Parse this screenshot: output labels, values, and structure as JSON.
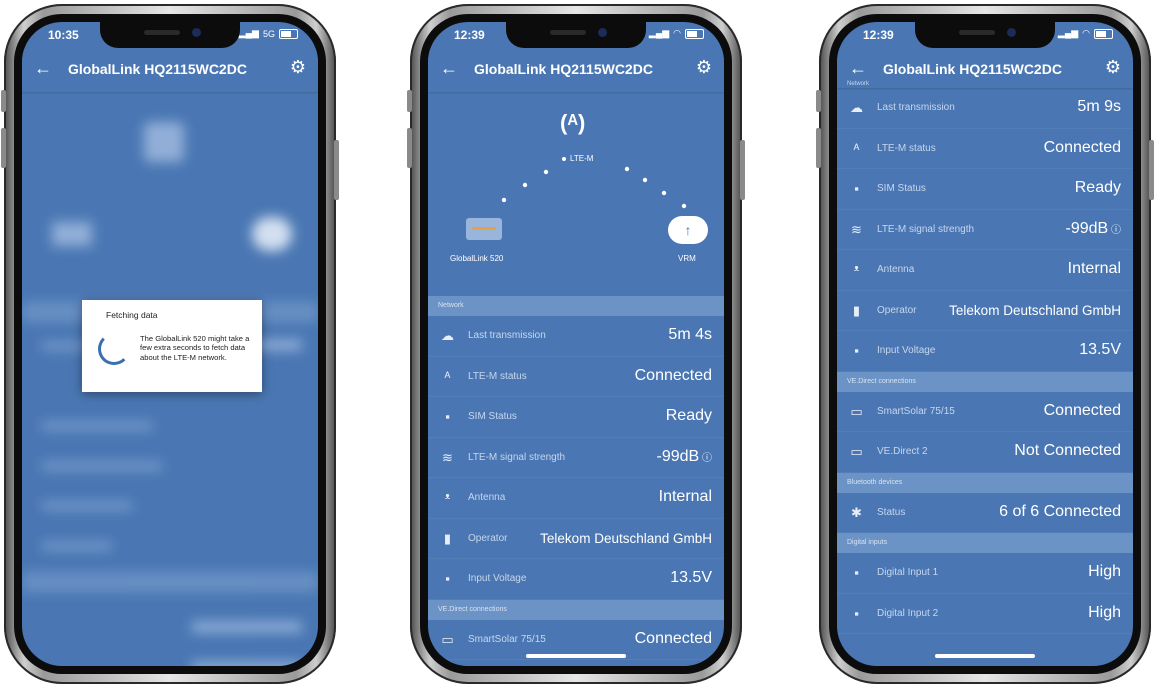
{
  "app": {
    "title": "GlobalLink HQ2115WC2DC",
    "back_icon": "arrow-left-icon",
    "settings_icon": "gear-icon",
    "accent": "#4a77b3"
  },
  "phones": [
    {
      "time": "10:35",
      "network": "5G",
      "dialog": {
        "title": "Fetching data",
        "message": "The GlobalLink 520 might take a few extra seconds to fetch data about the LTE-M network."
      }
    },
    {
      "time": "12:39",
      "diagram": {
        "network_type": "LTE-M",
        "device": "GlobalLink 520",
        "cloud": "VRM"
      },
      "sections": {
        "network": "Network",
        "ve_direct": "VE.Direct connections"
      },
      "rows": [
        {
          "label": "Last transmission",
          "value": "5m 4s",
          "icon": "cloud-upload-icon"
        },
        {
          "label": "LTE-M status",
          "value": "Connected",
          "icon": "antenna-icon"
        },
        {
          "label": "SIM Status",
          "value": "Ready",
          "icon": "sim-icon"
        },
        {
          "label": "LTE-M signal strength",
          "value": "-99dB",
          "icon": "wifi-icon"
        },
        {
          "label": "Antenna",
          "value": "Internal",
          "icon": "antenna-signal-icon"
        },
        {
          "label": "Operator",
          "value": "Telekom Deutschland GmbH",
          "icon": "operator-sim-icon"
        },
        {
          "label": "Input Voltage",
          "value": "13.5V",
          "icon": "power-icon"
        }
      ],
      "ve_rows": [
        {
          "label": "SmartSolar 75/15",
          "value": "Connected",
          "icon": "device-icon"
        }
      ]
    },
    {
      "time": "12:39",
      "header_cut": "Network",
      "rows": [
        {
          "label": "Last transmission",
          "value": "5m 9s",
          "icon": "cloud-upload-icon"
        },
        {
          "label": "LTE-M status",
          "value": "Connected",
          "icon": "antenna-icon"
        },
        {
          "label": "SIM Status",
          "value": "Ready",
          "icon": "sim-icon"
        },
        {
          "label": "LTE-M signal strength",
          "value": "-99dB",
          "icon": "wifi-icon"
        },
        {
          "label": "Antenna",
          "value": "Internal",
          "icon": "antenna-signal-icon"
        },
        {
          "label": "Operator",
          "value": "Telekom Deutschland GmbH",
          "icon": "operator-sim-icon"
        },
        {
          "label": "Input Voltage",
          "value": "13.5V",
          "icon": "power-icon"
        }
      ],
      "sections": {
        "ve_direct": "VE.Direct connections",
        "bluetooth": "Bluetooth devices",
        "digital": "Digital inputs"
      },
      "ve_rows": [
        {
          "label": "SmartSolar 75/15",
          "value": "Connected",
          "icon": "device-icon"
        },
        {
          "label": "VE.Direct 2",
          "value": "Not Connected",
          "icon": "device-icon"
        }
      ],
      "bt_rows": [
        {
          "label": "Status",
          "value": "6 of 6 Connected",
          "icon": "bluetooth-icon"
        }
      ],
      "digital_rows": [
        {
          "label": "Digital Input 1",
          "value": "High",
          "icon": "input-icon"
        },
        {
          "label": "Digital Input 2",
          "value": "High",
          "icon": "input-icon"
        }
      ]
    }
  ]
}
